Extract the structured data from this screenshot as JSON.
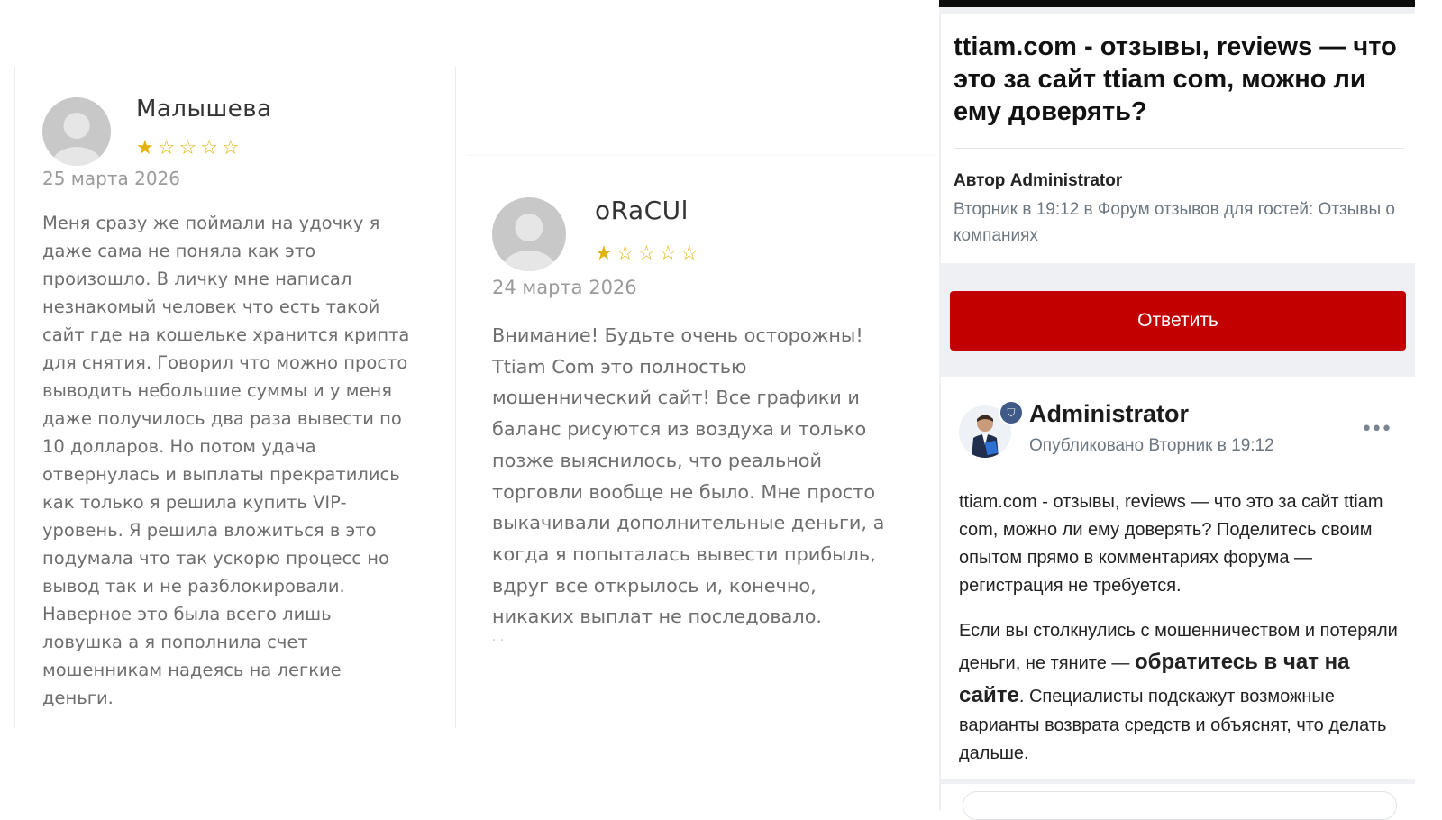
{
  "reviews": [
    {
      "name": "Малышева",
      "rating": 1,
      "rating_max": 5,
      "date": "25 марта 2026",
      "text": "Меня сразу же поймали на удочку я\nдаже сама не поняла как это\nпроизошло. В личку мне написал\nнезнакомый человек что есть такой\nсайт где на кошельке хранится крипта\nдля снятия. Говорил что можно просто\nвыводить небольшие суммы и у меня\nдаже получилось два раза вывести по\n10 долларов. Но потом удача\nотвернулась и выплаты прекратились\nкак только я решила купить VIP-\nуровень. Я решила вложиться в это\nподумала что так ускорю процесс но\nвывод так и не разблокировали.\nНаверное это была всего лишь\nловушка а я пополнила счет\nмошенникам надеясь на легкие\nденьги."
    },
    {
      "name": "oRaCUl",
      "rating": 1,
      "rating_max": 5,
      "date": "24 марта 2026",
      "text": "Внимание! Будьте очень осторожны!\nTtiam Com это полностью\nмошеннический сайт! Все графики и\nбаланс рисуются из воздуха и только\nпозже выяснилось, что реальной\nторговли вообще не было. Мне просто\nвыкачивали дополнительные деньги, а\nкогда я попыталась вывести прибыль,\nвдруг все открылось и, конечно,\nникаких выплат не последовало."
    }
  ],
  "icons": {
    "star_filled": "★",
    "star_empty": "☆",
    "more": "•••",
    "shield": "⛉"
  },
  "colors": {
    "star": "#e2b30f",
    "reply_button": "#c30000",
    "meta_text": "#6c7680"
  },
  "forum": {
    "topic_title": "ttiam.com - отзывы, reviews — что это за сайт ttiam com, можно ли ему доверять?",
    "author_line": "Автор Administrator",
    "meta_line": "Вторник в 19:12 в Форум отзывов для гостей: Отзывы о компаниях",
    "reply_label": "Ответить",
    "post": {
      "author": "Administrator",
      "published": "Опубликовано Вторник в 19:12",
      "paragraph1": "ttiam.com - отзывы, reviews — что это за сайт ttiam com, можно ли ему доверять? Поделитесь своим опытом прямо в комментариях форума — регистрация не требуется.",
      "paragraph2_start": "Если вы столкнулись с мошенничеством и потеряли деньги, не тяните — ",
      "paragraph2_bold": "обратитесь в чат на сайте",
      "paragraph2_end": ". Специалисты подскажут возможные варианты возврата средств и объяснят, что делать дальше."
    }
  }
}
